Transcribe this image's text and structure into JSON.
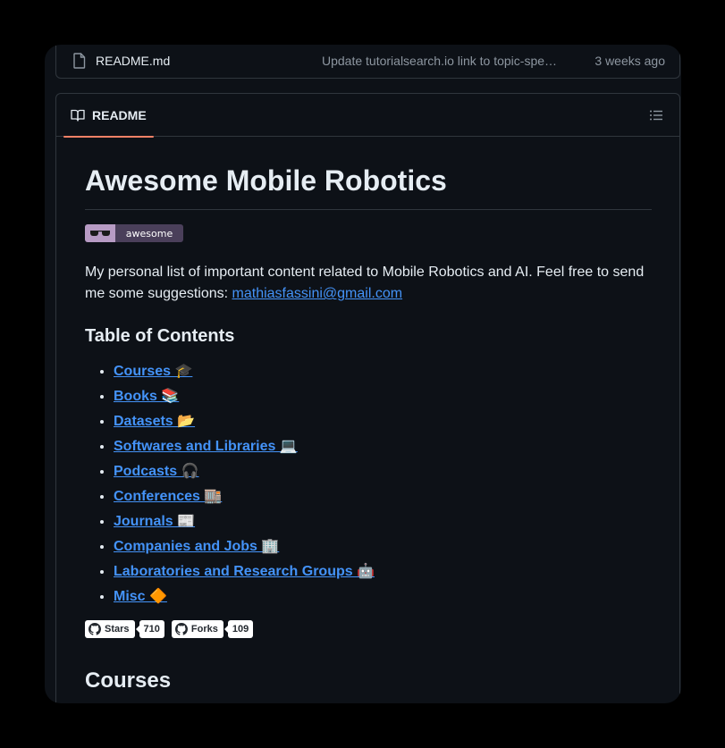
{
  "file_row": {
    "name": "README.md",
    "commit_message": "Update tutorialsearch.io link to topic-spe…",
    "time": "3 weeks ago"
  },
  "readme": {
    "tab_label": "README",
    "title": "Awesome Mobile Robotics",
    "badge_text": "awesome",
    "description": "My personal list of important content related to Mobile Robotics and AI. Feel free to send me some suggestions: ",
    "email": "mathiasfassini@gmail.com",
    "toc_title": "Table of Contents",
    "toc": [
      {
        "label": "Courses 🎓"
      },
      {
        "label": "Books 📚"
      },
      {
        "label": "Datasets 📂"
      },
      {
        "label": "Softwares and Libraries 💻"
      },
      {
        "label": "Podcasts 🎧"
      },
      {
        "label": "Conferences 🏬"
      },
      {
        "label": "Journals 📰"
      },
      {
        "label": "Companies and Jobs 🏢"
      },
      {
        "label": "Laboratories and Research Groups 🤖"
      },
      {
        "label": "Misc 🔶"
      }
    ],
    "stars_label": "Stars",
    "stars_count": "710",
    "forks_label": "Forks",
    "forks_count": "109",
    "section_title": "Courses"
  },
  "colors": {
    "background": "#0d1117",
    "link": "#4493f8",
    "tab_accent": "#f78166",
    "border": "#30363d"
  },
  "icons": {
    "file": "file-icon",
    "readme": "book-icon",
    "toc": "list-icon",
    "github": "github-logo-icon"
  }
}
